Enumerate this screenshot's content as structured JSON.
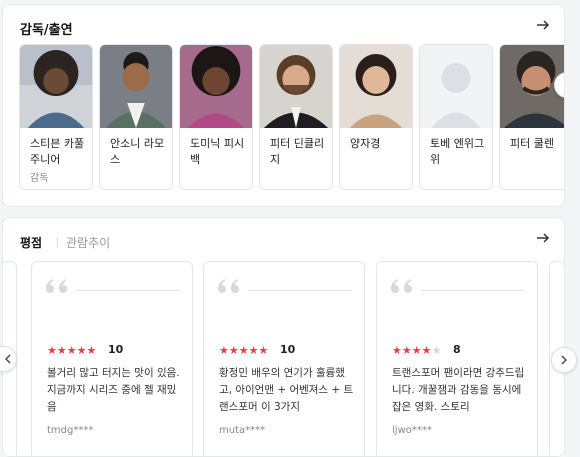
{
  "cast": {
    "title": "감독/출연",
    "people": [
      {
        "name": "스티븐 카풀 주니어",
        "role": "감독"
      },
      {
        "name": "안소니 라모스",
        "role": ""
      },
      {
        "name": "도미닉 피시백",
        "role": ""
      },
      {
        "name": "피터 딘클리지",
        "role": ""
      },
      {
        "name": "양자경",
        "role": ""
      },
      {
        "name": "토베 엔위그위",
        "role": ""
      },
      {
        "name": "피터 쿨렌",
        "role": ""
      }
    ]
  },
  "reviews": {
    "tabs": [
      "평점",
      "관람추이"
    ],
    "items": [
      {
        "rating": 10,
        "text": "볼거리 많고 터지는 맛이 있음. 지금까지 시리즈 중에 젤 재밌음",
        "user": "tmdg****"
      },
      {
        "rating": 10,
        "text": "황정민 배우의 연기가 훌륭했고, 아이언맨 + 어벤져스 + 트랜스포머 이 3가지",
        "user": "muta****"
      },
      {
        "rating": 8,
        "text": "트랜스포머 팬이라면 강추드립니다. 개꿀잼과 감동을 동시에 잡은 영화. 스토리",
        "user": "ljwo****"
      }
    ]
  },
  "colors": {
    "star": "#ef3a48",
    "star_off": "#d5d5d5"
  }
}
